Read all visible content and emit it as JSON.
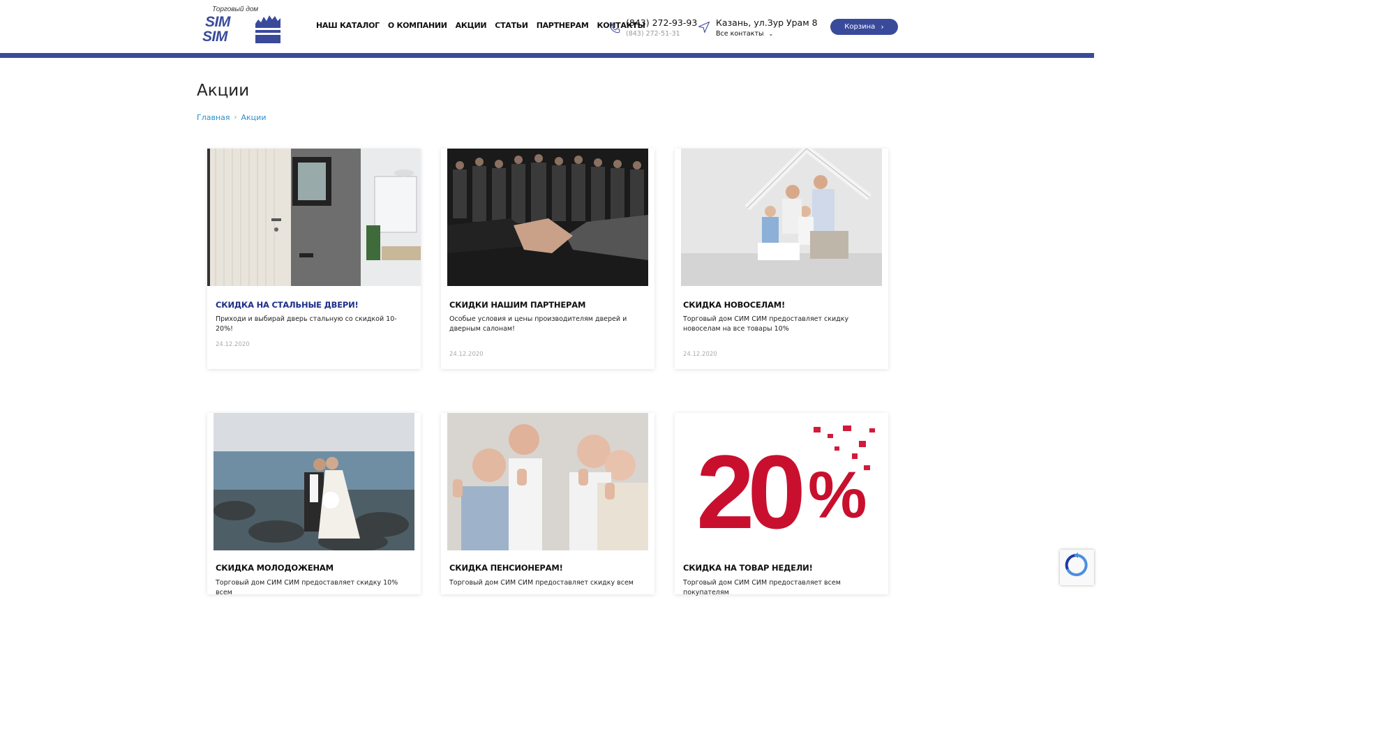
{
  "header": {
    "logo_tagline": "Торговый дом",
    "logo_line1": "SIM",
    "logo_line2": "SIM",
    "nav": [
      "НАШ КАТАЛОГ",
      "О КОМПАНИИ",
      "АКЦИИ",
      "СТАТЬИ",
      "ПАРТНЕРАМ",
      "КОНТАКТЫ"
    ],
    "phone_main": "(843) 272-93-93",
    "phone_secondary": "(843) 272-51-31",
    "address": "Казань, ул.Зур Урам 8",
    "all_contacts": "Все контакты",
    "cart_label": "Корзина",
    "brand_color": "#3a4a9b"
  },
  "page": {
    "title": "Акции",
    "breadcrumbs": [
      "Главная",
      "Акции"
    ]
  },
  "cards": [
    {
      "title": "СКИДКА НА СТАЛЬНЫЕ ДВЕРИ!",
      "desc": "Приходи и выбирай дверь стальную со скидкой 10-20%!",
      "date": "24.12.2020",
      "image": "steel-door-interior"
    },
    {
      "title": "СКИДКИ НАШИМ ПАРТНЕРАМ",
      "desc": "Особые условия и цены производителям дверей и дверным салонам!",
      "date": "24.12.2020",
      "image": "business-handshake"
    },
    {
      "title": "СКИДКА НОВОСЕЛАМ!",
      "desc": "Торговый дом СИМ СИМ предоставляет скидку новоселам на все товары 10%",
      "date": "24.12.2020",
      "image": "family-under-roof"
    },
    {
      "title": "СКИДКА МОЛОДОЖЕНАМ",
      "desc": "Торговый дом СИМ СИМ предоставляет скидку 10% всем",
      "date": "",
      "image": "wedding-couple-sea"
    },
    {
      "title": "СКИДКА ПЕНСИОНЕРАМ!",
      "desc": "Торговый дом СИМ СИМ предоставляет скидку всем",
      "date": "",
      "image": "seniors-thumbs-up"
    },
    {
      "title": "СКИДКА НА ТОВАР НЕДЕЛИ!",
      "desc": "Торговый дом СИМ СИМ предоставляет всем покупателям",
      "date": "",
      "image": "red-20-percent"
    }
  ]
}
